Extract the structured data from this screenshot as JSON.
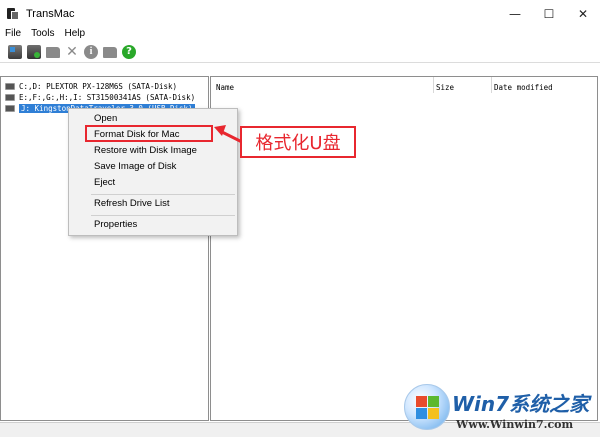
{
  "window": {
    "title": "TransMac",
    "minimize_glyph": "—",
    "maximize_glyph": "☐",
    "close_glyph": "✕"
  },
  "menubar": [
    "File",
    "Tools",
    "Help"
  ],
  "toolbar": {
    "icons": [
      "disk-icon",
      "disk-add-icon",
      "folder-icon",
      "delete-icon",
      "info-icon",
      "folder-icon",
      "help-icon"
    ],
    "info_glyph": "i",
    "delete_glyph": "✕",
    "help_glyph": "?"
  },
  "drive_tree": [
    {
      "label": "C:,D: PLEXTOR PX-128M6S (SATA-Disk)",
      "selected": false
    },
    {
      "label": "E:,F:,G:,H:,I: ST31500341AS (SATA-Disk)",
      "selected": false
    },
    {
      "label": "J: KingstonDataTraveler 3.0 (USB-Disk)",
      "selected": true
    }
  ],
  "file_list": {
    "columns": [
      "Name",
      "Size",
      "Date modified"
    ]
  },
  "context_menu": {
    "items": [
      {
        "label": "Open",
        "highlighted": false
      },
      {
        "label": "Format Disk for Mac",
        "highlighted": true
      },
      {
        "label": "Restore with Disk Image",
        "highlighted": false
      },
      {
        "label": "Save Image of Disk",
        "highlighted": false
      },
      {
        "label": "Eject",
        "highlighted": false
      },
      {
        "label": "Refresh Drive List",
        "highlighted": false
      },
      {
        "label": "Properties",
        "highlighted": false
      }
    ]
  },
  "annotation": {
    "text": "格式化U盘",
    "color": "#e8272f"
  },
  "watermark": {
    "brand": "Win7系统之家",
    "url": "Www.Winwin7.com"
  },
  "colors": {
    "selection": "#2f7fd6",
    "accent_red": "#e8272f"
  }
}
